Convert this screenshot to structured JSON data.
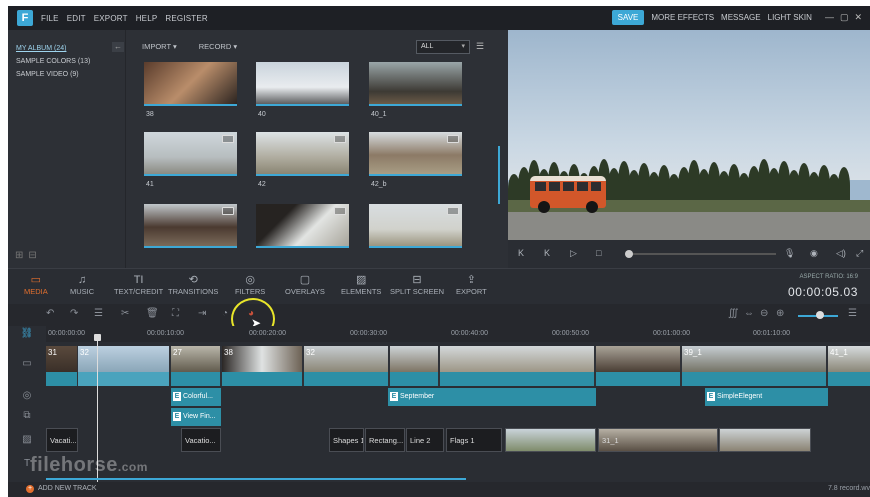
{
  "menubar": {
    "logo": "F",
    "items": [
      "FILE",
      "EDIT",
      "EXPORT",
      "HELP",
      "REGISTER"
    ],
    "save": "SAVE",
    "right_items": [
      "MORE EFFECTS",
      "MESSAGE",
      "LIGHT SKIN"
    ],
    "window_controls": [
      "—",
      "▢",
      "✕"
    ]
  },
  "library": {
    "albums": [
      "MY ALBUM (24)",
      "SAMPLE COLORS (13)",
      "SAMPLE VIDEO (9)"
    ],
    "import_label": "IMPORT",
    "record_label": "RECORD",
    "filter_value": "ALL",
    "thumbnails": [
      {
        "label": "38"
      },
      {
        "label": "40"
      },
      {
        "label": "40_1"
      },
      {
        "label": "41"
      },
      {
        "label": "42"
      },
      {
        "label": "42_b"
      },
      {
        "label": ""
      },
      {
        "label": ""
      },
      {
        "label": ""
      }
    ]
  },
  "player": {
    "controls": [
      "skip-back-icon",
      "step-back-icon",
      "play-icon",
      "stop-icon",
      "mic-icon",
      "camera-icon",
      "volume-icon",
      "fullscreen-icon"
    ],
    "progress": 0.02
  },
  "toolbar": {
    "tabs": [
      {
        "label": "MEDIA",
        "icon": "folder-icon",
        "active": true
      },
      {
        "label": "MUSIC",
        "icon": "music-icon"
      },
      {
        "label": "TEXT/CREDIT",
        "icon": "text-icon"
      },
      {
        "label": "TRANSITIONS",
        "icon": "transitions-icon"
      },
      {
        "label": "FILTERS",
        "icon": "filters-icon"
      },
      {
        "label": "OVERLAYS",
        "icon": "overlays-icon"
      },
      {
        "label": "ELEMENTS",
        "icon": "elements-icon"
      },
      {
        "label": "SPLIT SCREEN",
        "icon": "split-screen-icon"
      },
      {
        "label": "EXPORT",
        "icon": "export-icon"
      }
    ],
    "aspect_ratio": "ASPECT RATIO: 16:9",
    "timecode": "00:00:05.03"
  },
  "ruler": [
    "00:00:00:00",
    "00:00:10:00",
    "00:00:20:00",
    "00:00:30:00",
    "00:00:40:00",
    "00:00:50:00",
    "00:01:00:00",
    "00:01:10:00"
  ],
  "video_clips": [
    {
      "num": "31"
    },
    {
      "num": "32"
    },
    {
      "num": "27"
    },
    {
      "num": "38"
    },
    {
      "num": "32"
    },
    {
      "num": ""
    },
    {
      "num": ""
    },
    {
      "num": ""
    },
    {
      "num": "39_1"
    },
    {
      "num": ""
    },
    {
      "num": "41_1"
    }
  ],
  "filter_clips": [
    "Colorful...",
    "September",
    "SimpleElegent"
  ],
  "overlay_clips": [
    "View Fin..."
  ],
  "text_clips": [
    "Vacati...",
    "Vacatio...",
    "Shapes 1",
    "Rectang...",
    "Line 2",
    "Flags 1",
    "",
    "31_1",
    ""
  ],
  "bottom": {
    "add_track": "ADD NEW TRACK",
    "record_file": "7.8 record.wv"
  },
  "watermark": "filehorse",
  "watermark_suffix": ".com"
}
